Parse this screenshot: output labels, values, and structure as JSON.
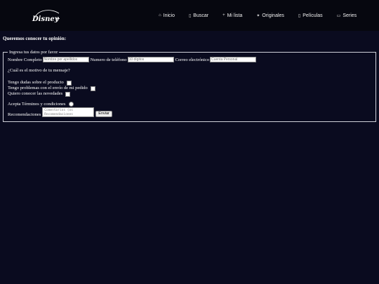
{
  "brand": {
    "logo_alt": "Disney+"
  },
  "nav": [
    {
      "icon": "home-icon",
      "glyph": "⌂",
      "label": "Inicio"
    },
    {
      "icon": "search-icon",
      "glyph": "▯",
      "label": "Buscar"
    },
    {
      "icon": "plus-icon",
      "glyph": "+",
      "label": "Mi lista"
    },
    {
      "icon": "star-icon",
      "glyph": "✦",
      "label": "Originales"
    },
    {
      "icon": "movie-icon",
      "glyph": "▯",
      "label": "Películas"
    },
    {
      "icon": "tv-icon",
      "glyph": "▭",
      "label": "Series"
    }
  ],
  "form": {
    "heading": "Queremos conocer tu opinión:",
    "legend": "Ingresa tus datos por favor",
    "name_label": "Nombre Completo",
    "name_placeholder": "Nombre por apellidos",
    "phone_label": "Numero de teléfono",
    "phone_placeholder": "10 dígitos",
    "email_label": "Correo electrónico",
    "email_placeholder": "Cuenta Personal",
    "question": "¿Cuál es el motivo de tu mensaje?",
    "options": [
      "Tengo dudas sobre el producto",
      "Tengo problemas con el envío de mi pedido",
      "Quiero conocer las novedades"
    ],
    "terms_label": "Acepta Términos y condiciones",
    "recs_label": "Recomendaciones",
    "textarea_placeholder": "Comentarios (os\nRecomendaciones",
    "submit_label": "Enviar"
  }
}
